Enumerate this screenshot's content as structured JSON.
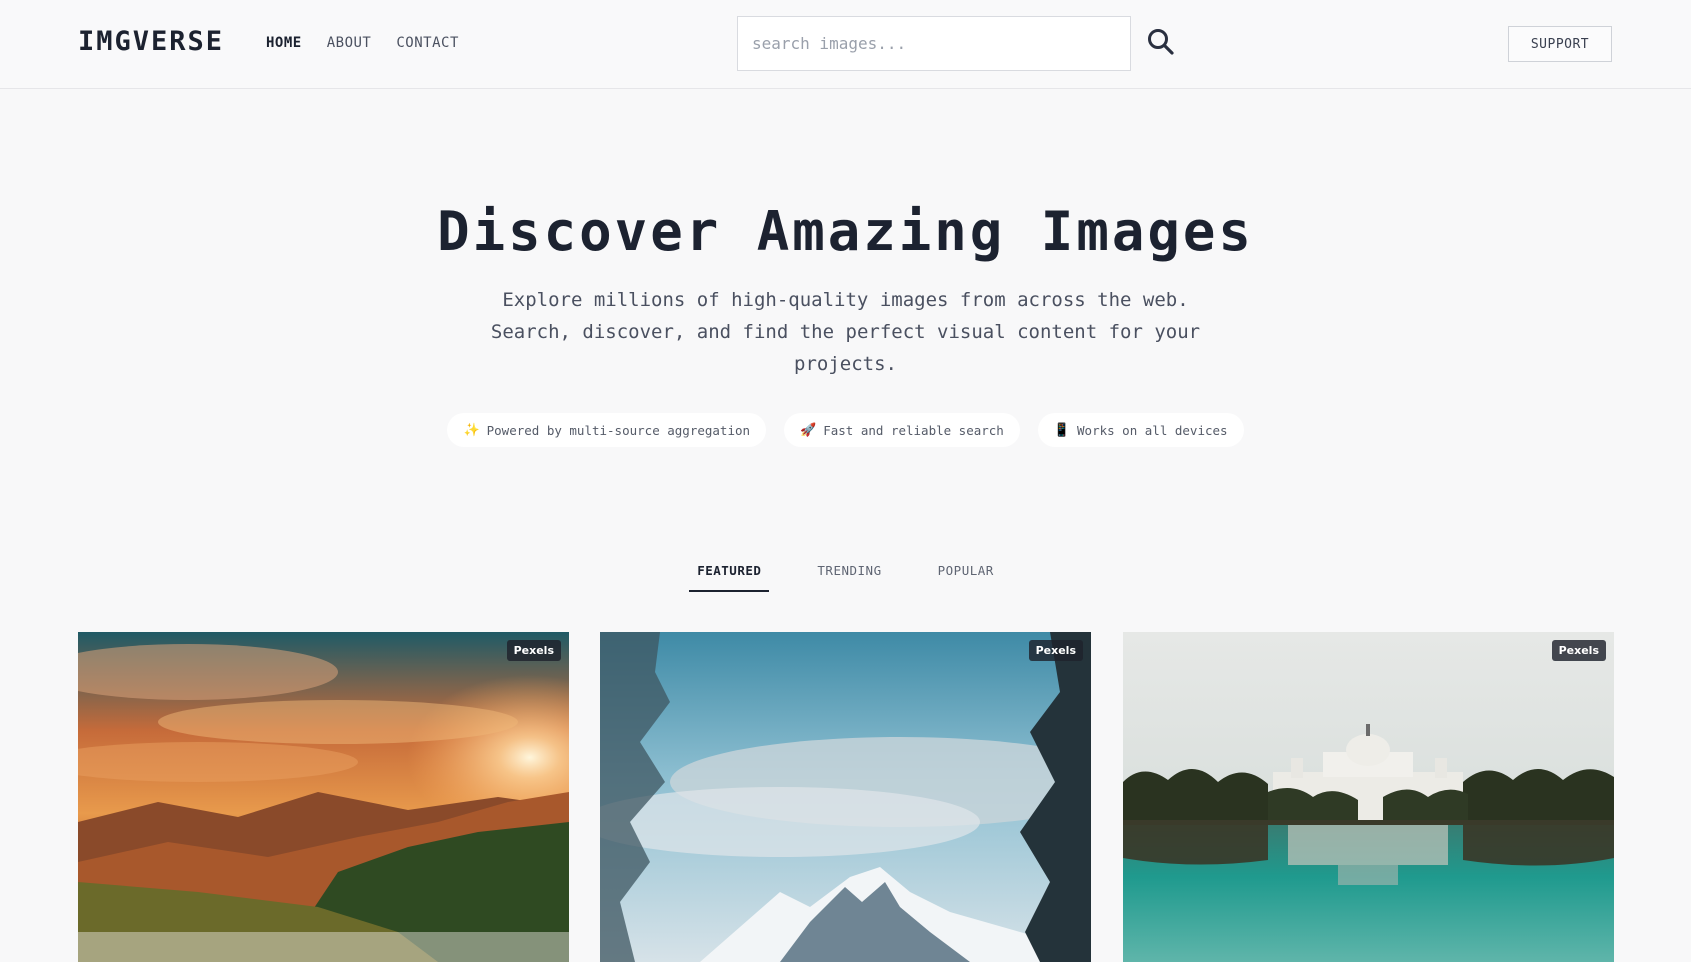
{
  "brand": {
    "logo": "IMGVERSE"
  },
  "nav": {
    "items": [
      "HOME",
      "ABOUT",
      "CONTACT"
    ]
  },
  "search": {
    "placeholder": "search images...",
    "value": ""
  },
  "support_label": "SUPPORT",
  "hero": {
    "title": "Discover Amazing Images",
    "subtitle": "Explore millions of high-quality images from across the web. Search, discover, and find the perfect visual content for your projects."
  },
  "features": [
    {
      "icon": "sparkles-icon",
      "glyph": "✨",
      "text": "Powered by multi-source aggregation"
    },
    {
      "icon": "rocket-icon",
      "glyph": "🚀",
      "text": "Fast and reliable search"
    },
    {
      "icon": "mobile-phone-icon",
      "glyph": "📱",
      "text": "Works on all devices"
    }
  ],
  "tabs": [
    "FEATURED",
    "TRENDING",
    "POPULAR"
  ],
  "active_tab": "FEATURED",
  "cards": [
    {
      "source": "Pexels",
      "subject": "sunset mountain valley"
    },
    {
      "source": "Pexels",
      "subject": "snowy mountain with pine trees"
    },
    {
      "source": "Pexels",
      "subject": "white palace reflected in lake"
    }
  ],
  "colors": {
    "text_dark": "#1c2230",
    "accent_line": "#1c2230",
    "background": "#f8f8f9"
  }
}
